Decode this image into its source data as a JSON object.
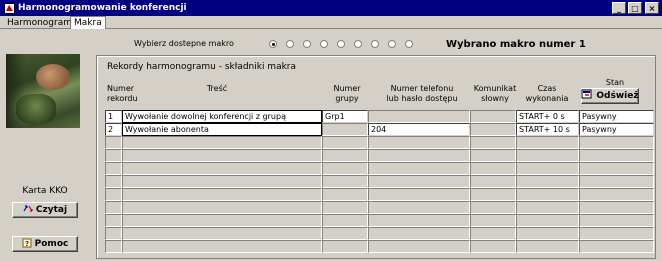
{
  "window": {
    "title": "Harmonogramowanie konferencji"
  },
  "tabs": [
    {
      "label": "Harmonogram",
      "active": false
    },
    {
      "label": "Makra",
      "active": true
    }
  ],
  "left_panel": {
    "card_label": "Karta KKO",
    "read_button": "Czytaj",
    "help_button": "Pomoc"
  },
  "macro_select": {
    "label": "Wybierz dostepne makro",
    "radios": [
      true,
      false,
      false,
      false,
      false,
      false,
      false,
      false,
      false
    ],
    "selected_text": "Wybrano makro numer 1"
  },
  "records": {
    "group_title": "Rekordy harmonogramu - składniki makra",
    "headers": {
      "num_line1": "Numer",
      "num_line2": "rekordu",
      "content": "Treść",
      "group_line1": "Numer",
      "group_line2": "grupy",
      "phone_line1": "Numer telefonu",
      "phone_line2": "lub hasło dostępu",
      "msg_line1": "Komunikat",
      "msg_line2": "słowny",
      "time_line1": "Czas",
      "time_line2": "wykonania",
      "state": "Stan"
    },
    "refresh_button": "Odśwież",
    "rows": [
      {
        "num": "1",
        "content": "Wywołanie dowolnej konferencji z grupą",
        "group": "Grp1",
        "phone": "",
        "msg": "",
        "time": "START+ 0 s",
        "state": "Pasywny"
      },
      {
        "num": "2",
        "content": "Wywołanie abonenta",
        "group": "",
        "phone": "204",
        "msg": "",
        "time": "START+ 10 s",
        "state": "Pasywny"
      },
      {
        "num": "",
        "content": "",
        "group": "",
        "phone": "",
        "msg": "",
        "time": "",
        "state": ""
      },
      {
        "num": "",
        "content": "",
        "group": "",
        "phone": "",
        "msg": "",
        "time": "",
        "state": ""
      },
      {
        "num": "",
        "content": "",
        "group": "",
        "phone": "",
        "msg": "",
        "time": "",
        "state": ""
      },
      {
        "num": "",
        "content": "",
        "group": "",
        "phone": "",
        "msg": "",
        "time": "",
        "state": ""
      },
      {
        "num": "",
        "content": "",
        "group": "",
        "phone": "",
        "msg": "",
        "time": "",
        "state": ""
      },
      {
        "num": "",
        "content": "",
        "group": "",
        "phone": "",
        "msg": "",
        "time": "",
        "state": ""
      },
      {
        "num": "",
        "content": "",
        "group": "",
        "phone": "",
        "msg": "",
        "time": "",
        "state": ""
      },
      {
        "num": "",
        "content": "",
        "group": "",
        "phone": "",
        "msg": "",
        "time": "",
        "state": ""
      },
      {
        "num": "",
        "content": "",
        "group": "",
        "phone": "",
        "msg": "",
        "time": "",
        "state": ""
      }
    ]
  },
  "colors": {
    "titlebar": "#000080",
    "face": "#d4d0c8"
  }
}
